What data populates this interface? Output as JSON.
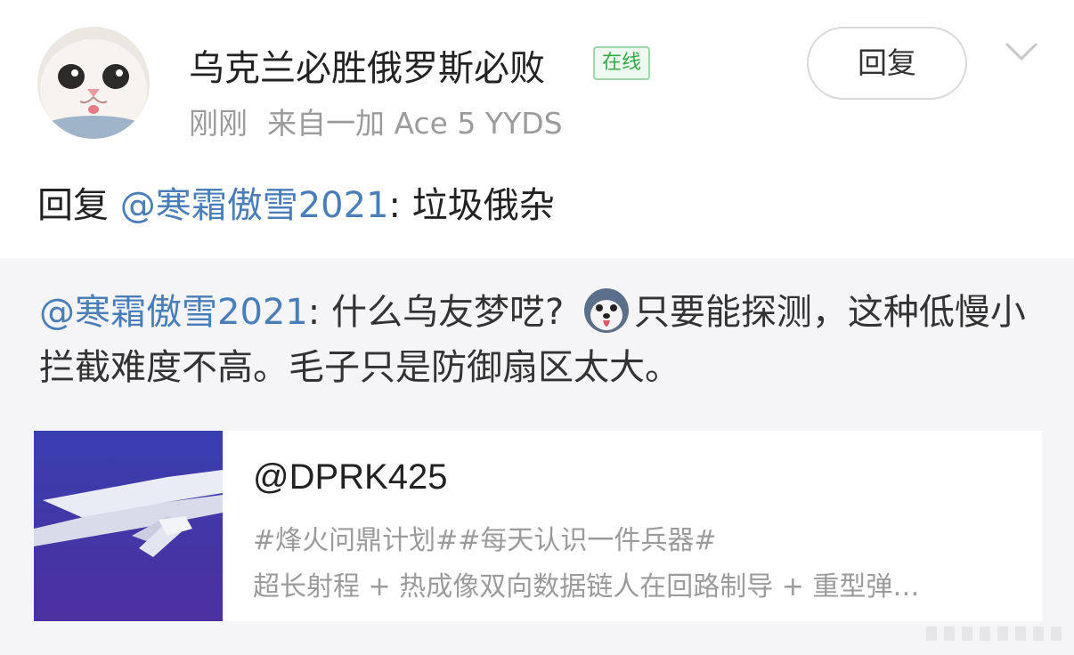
{
  "post": {
    "username": "乌克兰必胜俄罗斯必败",
    "online_badge": "在线",
    "time": "刚刚",
    "source": "来自一加 Ace 5 YYDS",
    "reply_button": "回复",
    "reply_prefix": "回复",
    "reply_mention": "@寒霜傲雪2021",
    "reply_content": ": 垃圾俄杂"
  },
  "quote": {
    "mention": "@寒霜傲雪2021",
    "text_before_emoji": ": 什么乌友梦呓? ",
    "emoji_icon": "husky-tongue-emoji",
    "text_after_emoji": "只要能探测，这种低慢小拦截难度不高。毛子只是防御扇区太大。"
  },
  "card": {
    "title": "@DPRK425",
    "line1": "#烽火问鼎计划##每天认识一件兵器#",
    "line2": "超长射程 + 热成像双向数据链人在回路制导 + 重型弹…"
  },
  "colors": {
    "mention": "#4a7eb8",
    "online_badge": "#35a94a",
    "quote_background": "#f5f5f7",
    "thumbnail_background": "#3f3aa6"
  }
}
